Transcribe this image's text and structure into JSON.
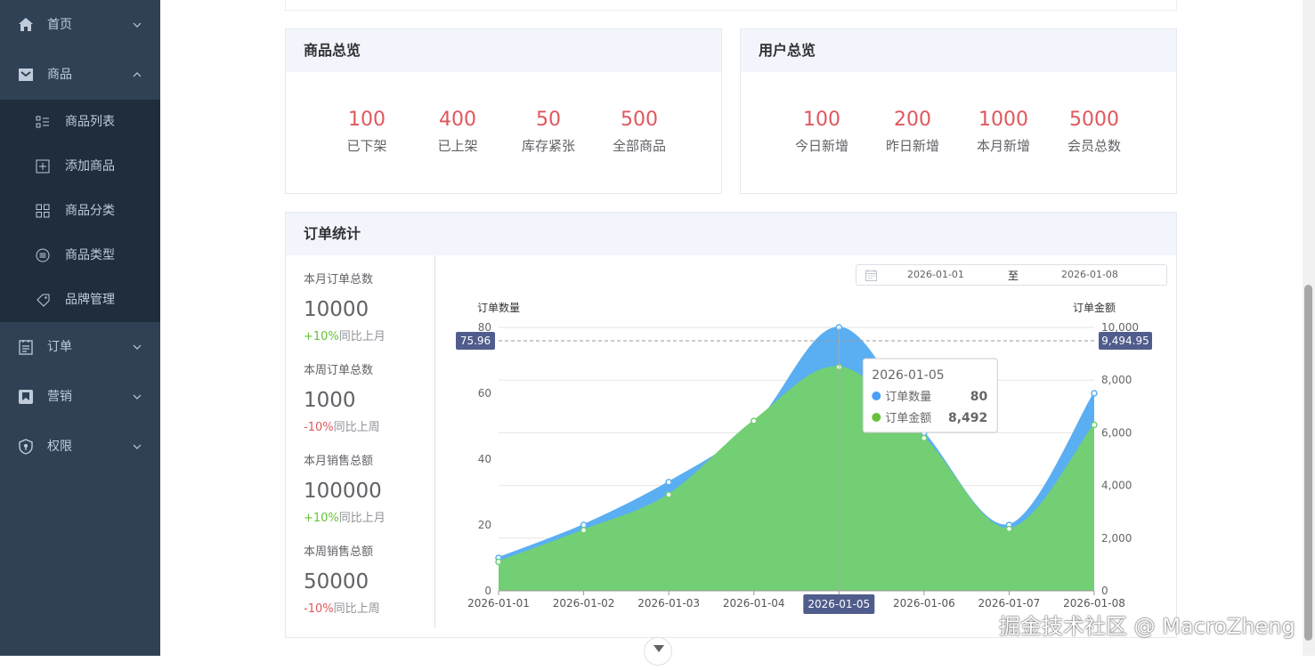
{
  "sidebar": {
    "menus": [
      {
        "label": "首页",
        "icon": "home-icon"
      },
      {
        "label": "商品",
        "icon": "goods-icon"
      },
      {
        "label": "订单",
        "icon": "order-icon"
      },
      {
        "label": "营销",
        "icon": "marketing-icon"
      },
      {
        "label": "权限",
        "icon": "permission-icon"
      }
    ],
    "goods_submenu": [
      {
        "label": "商品列表",
        "icon": "list-icon"
      },
      {
        "label": "添加商品",
        "icon": "add-icon"
      },
      {
        "label": "商品分类",
        "icon": "category-icon"
      },
      {
        "label": "商品类型",
        "icon": "type-icon"
      },
      {
        "label": "品牌管理",
        "icon": "tag-icon"
      }
    ]
  },
  "goods_overview": {
    "title": "商品总览",
    "stats": [
      {
        "value": "100",
        "label": "已下架"
      },
      {
        "value": "400",
        "label": "已上架"
      },
      {
        "value": "50",
        "label": "库存紧张"
      },
      {
        "value": "500",
        "label": "全部商品"
      }
    ]
  },
  "user_overview": {
    "title": "用户总览",
    "stats": [
      {
        "value": "100",
        "label": "今日新增"
      },
      {
        "value": "200",
        "label": "昨日新增"
      },
      {
        "value": "1000",
        "label": "本月新增"
      },
      {
        "value": "5000",
        "label": "会员总数"
      }
    ]
  },
  "order_stats": {
    "title": "订单统计",
    "metrics": [
      {
        "label": "本月订单总数",
        "value": "10000",
        "change": "+10%",
        "compare": "同比上月",
        "trend": "up"
      },
      {
        "label": "本周订单总数",
        "value": "1000",
        "change": "-10%",
        "compare": "同比上周",
        "trend": "down"
      },
      {
        "label": "本月销售总额",
        "value": "100000",
        "change": "+10%",
        "compare": "同比上月",
        "trend": "up"
      },
      {
        "label": "本周销售总额",
        "value": "50000",
        "change": "-10%",
        "compare": "同比上周",
        "trend": "down"
      }
    ],
    "date_range": {
      "start": "2026-01-01",
      "separator": "至",
      "end": "2026-01-08"
    }
  },
  "chart_data": {
    "type": "area",
    "categories": [
      "2026-01-01",
      "2026-01-02",
      "2026-01-03",
      "2026-01-04",
      "2026-01-05",
      "2026-01-06",
      "2026-01-07",
      "2026-01-08"
    ],
    "y_left": {
      "label": "订单数量",
      "ticks": [
        "0",
        "20",
        "40",
        "60",
        "80"
      ],
      "min": 0,
      "max": 80
    },
    "y_right": {
      "label": "订单金额",
      "ticks": [
        "0",
        "2,000",
        "4,000",
        "6,000",
        "8,000",
        "10,000"
      ],
      "min": 0,
      "max": 10000
    },
    "series": [
      {
        "name": "订单数量",
        "axis": "left",
        "color": "#5aaef2",
        "values": [
          10,
          20,
          33,
          50,
          80,
          48,
          20,
          60
        ]
      },
      {
        "name": "订单金额",
        "axis": "right",
        "color": "#72cf74",
        "values": [
          1100,
          2300,
          3650,
          6450,
          8492,
          5800,
          2350,
          6300
        ]
      }
    ],
    "pointer": {
      "left_label": "75.96",
      "right_label": "9,494.95",
      "x_label": "2026-01-05"
    },
    "tooltip": {
      "title": "2026-01-05",
      "rows": [
        {
          "name": "订单数量",
          "value": "80",
          "color": "#4a9ff5"
        },
        {
          "name": "订单金额",
          "value": "8,492",
          "color": "#67c23a"
        }
      ]
    }
  },
  "watermark": "掘金技术社区 @ MacroZheng"
}
